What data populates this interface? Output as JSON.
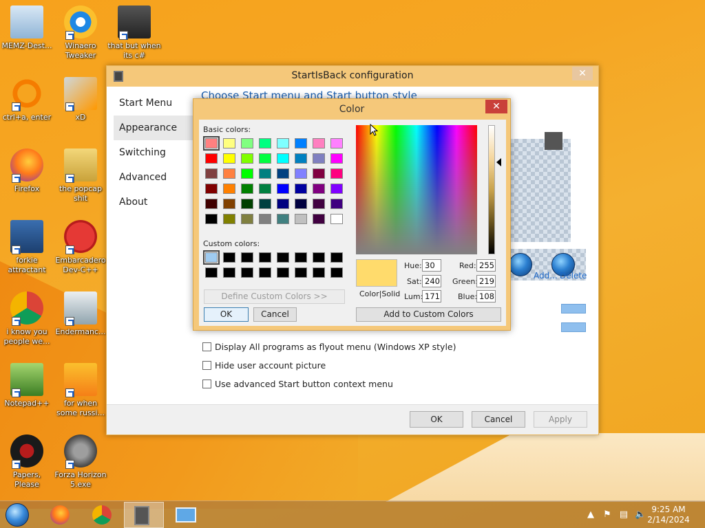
{
  "desktop": {
    "icons": [
      {
        "label": "MEMZ-Dest...",
        "icon": "recycle-bin-icon"
      },
      {
        "label": "Winaero Tweaker",
        "icon": "winaero-icon"
      },
      {
        "label": "that but when its c#",
        "icon": "window-stack-icon"
      },
      {
        "label": "ctrl+a, enter",
        "icon": "ring-icon"
      },
      {
        "label": "xD",
        "icon": "hxd-icon"
      },
      {
        "label": "Firefox",
        "icon": "firefox-icon"
      },
      {
        "label": "the popcap shit",
        "icon": "folder-icon"
      },
      {
        "label": "forkie attractant",
        "icon": "settings-monitor-icon"
      },
      {
        "label": "Embarcadero Dev-C++",
        "icon": "devcpp-icon"
      },
      {
        "label": "i know you people we...",
        "icon": "chrome-icon"
      },
      {
        "label": "Endermanc...",
        "icon": "window-app-icon"
      },
      {
        "label": "Notepad++",
        "icon": "notepadpp-icon"
      },
      {
        "label": "for when some russi...",
        "icon": "de-icon"
      },
      {
        "label": "Papers, Please",
        "icon": "papers-please-icon"
      },
      {
        "label": "Forza Horizon 5.exe",
        "icon": "flash-icon"
      }
    ]
  },
  "main_window": {
    "title": "StartIsBack configuration",
    "close": "✕",
    "nav": [
      "Start Menu",
      "Appearance",
      "Switching",
      "Advanced",
      "About"
    ],
    "section_title": "Choose Start menu and Start button style",
    "links": {
      "add": "Add...",
      "delete": "Delete"
    },
    "checkboxes": [
      "Display All programs as flyout menu (Windows XP style)",
      "Hide user account picture",
      "Use advanced Start button context menu"
    ],
    "buttons": {
      "ok": "OK",
      "cancel": "Cancel",
      "apply": "Apply"
    }
  },
  "color_dialog": {
    "title": "Color",
    "close": "✕",
    "basic_colors_label": "Basic colors:",
    "custom_colors_label": "Custom colors:",
    "basic_colors": [
      [
        "#ff8080",
        "#ffff80",
        "#80ff80",
        "#00ff80",
        "#80ffff",
        "#0080ff",
        "#ff80c0",
        "#ff80ff"
      ],
      [
        "#ff0000",
        "#ffff00",
        "#80ff00",
        "#00ff40",
        "#00ffff",
        "#0080c0",
        "#8080c0",
        "#ff00ff"
      ],
      [
        "#804040",
        "#ff8040",
        "#00ff00",
        "#008080",
        "#004080",
        "#8080ff",
        "#800040",
        "#ff0080"
      ],
      [
        "#800000",
        "#ff8000",
        "#008000",
        "#008040",
        "#0000ff",
        "#0000a0",
        "#800080",
        "#8000ff"
      ],
      [
        "#400000",
        "#804000",
        "#004000",
        "#004040",
        "#000080",
        "#000040",
        "#400040",
        "#400080"
      ],
      [
        "#000000",
        "#808000",
        "#808040",
        "#808080",
        "#408080",
        "#c0c0c0",
        "#400040",
        "#ffffff"
      ]
    ],
    "custom_colors": [
      [
        "#9fcbf0",
        "#000000",
        "#000000",
        "#000000",
        "#000000",
        "#000000",
        "#000000",
        "#000000"
      ],
      [
        "#000000",
        "#000000",
        "#000000",
        "#000000",
        "#000000",
        "#000000",
        "#000000",
        "#000000"
      ]
    ],
    "define_custom": "Define Custom Colors >>",
    "ok": "OK",
    "cancel": "Cancel",
    "color_solid": "Color|Solid",
    "hue_label": "Hue:",
    "hue": "30",
    "sat_label": "Sat:",
    "sat": "240",
    "lum_label": "Lum:",
    "lum": "171",
    "red_label": "Red:",
    "red": "255",
    "green_label": "Green:",
    "green": "219",
    "blue_label": "Blue:",
    "blue": "108",
    "add_custom": "Add to Custom Colors",
    "current_color": "#ffdb6c"
  },
  "taskbar": {
    "time": "9:25 AM",
    "date": "2/14/2024"
  }
}
